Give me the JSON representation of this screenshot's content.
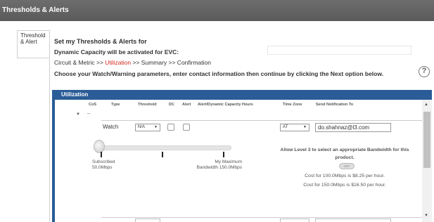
{
  "window": {
    "title": "Thresholds & Alerts"
  },
  "side_tab": {
    "label": "Threshold & Alert"
  },
  "header": {
    "line1": "Set my Thresholds & Alerts for",
    "line2": "Dynamic Capacity will be activated for EVC:"
  },
  "breadcrumb": {
    "step1": "Circuit & Metric >> ",
    "step2": "Utilization",
    "step3": " >> Summary >> Confirmation"
  },
  "instructions": "Choose your Watch/Warning parameters, enter contact information then continue by clicking the Next option below.",
  "help_icon": {
    "glyph": "?",
    "icon": "question-mark-icon"
  },
  "panel": {
    "title": "Utilization",
    "columns": [
      "CoS",
      "Type",
      "Threshold",
      "DC",
      "Alert",
      "Alert/Dynamic Capacity Hours",
      "Time Zone",
      "Send Notification To"
    ]
  },
  "group": {
    "expand_icon": "triangle-down-icon",
    "label": "--"
  },
  "row": {
    "type": "Watch",
    "threshold": "N/A",
    "timezone": "AT",
    "notify_email": "do.shahnaz@l3.com"
  },
  "slider": {
    "left_label_1": "Subscribed",
    "left_label_2": "50.0Mbps",
    "right_label_1": "My Maximum",
    "right_label_2": "Bandwidth 150.0Mbps"
  },
  "bandwidth": {
    "allow_text": "Allow Level 3 to select an appropriate Bandwidth for this product.",
    "toggle_text": "OFF",
    "cost1": "Cost for 100.0Mbps is $8.25 per hour.",
    "cost2": "Cost for 150.0Mbps is $16.50 per hour."
  },
  "colors": {
    "title_bar": "#5f5f5f",
    "panel_header": "#2a5c97",
    "active_step": "#d0271d"
  }
}
